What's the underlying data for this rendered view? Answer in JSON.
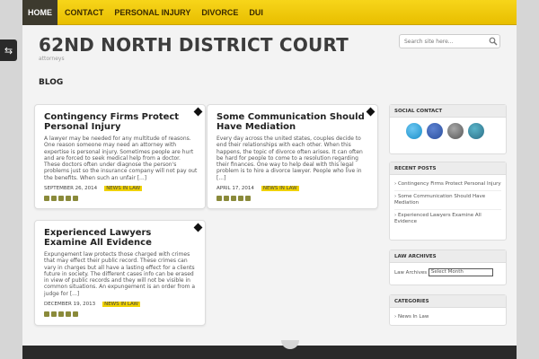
{
  "nav": {
    "items": [
      "HOME",
      "CONTACT",
      "PERSONAL INJURY",
      "DIVORCE",
      "DUI"
    ]
  },
  "site": {
    "title": "62ND NORTH DISTRICT COURT",
    "tagline": "attorneys"
  },
  "search": {
    "placeholder": "Search site here..."
  },
  "section": {
    "title": "BLOG"
  },
  "posts": [
    {
      "title": "Contingency Firms Protect Personal Injury",
      "excerpt": "A lawyer may be needed for any multitude of reasons. One reason someone may need an attorney with expertise is personal injury. Sometimes people are hurt  and are forced to seek medical help from a doctor. These doctors often under diagnose the person's problems just so the insurance company will not pay out the benefits. When such an unfair [...]",
      "date": "SEPTEMBER 26, 2014",
      "category": "NEWS IN LAW"
    },
    {
      "title": "Some Communication Should Have Mediation",
      "excerpt": "Every day across the united states, couples decide to end their relationships with each other. When this happens, the topic of divorce often arises. It can often be hard for people to come to a resolution regarding their finances. One way to help deal with this legal problem is to hire a divorce lawyer. People who live in [...]",
      "date": "APRIL 17, 2014",
      "category": "NEWS IN LAW"
    },
    {
      "title": "Experienced Lawyers Examine All Evidence",
      "excerpt": "Expungement law protects those charged with crimes that may effect their public record.  These crimes can vary in charges but all have a lasting effect for a clients future in society. The different cases info can be erased in view of  public records and they will not be visible in common situations. An expungement is an order from a judge for [...]",
      "date": "DECEMBER 19, 2013",
      "category": "NEWS IN LAW"
    }
  ],
  "sidebar": {
    "social_title": "SOCIAL CONTACT",
    "social_icons": [
      "twitter-icon",
      "facebook-icon",
      "google-plus-icon",
      "rss-icon"
    ],
    "recent_title": "RECENT POSTS",
    "recent": [
      "Contingency Firms Protect Personal Injury",
      "Some Communication Should Have Mediation",
      "Experienced Lawyers Examine All Evidence"
    ],
    "archives_title": "LAW ARCHIVES",
    "archives_label": "Law Archives",
    "archives_select": "Select Month",
    "categories_title": "CATEGORIES",
    "categories": [
      "News In Law"
    ]
  },
  "colors": {
    "accent": "#f2cf0a",
    "nav_active": "#3d3a2e",
    "footer": "#2a2a2a"
  }
}
